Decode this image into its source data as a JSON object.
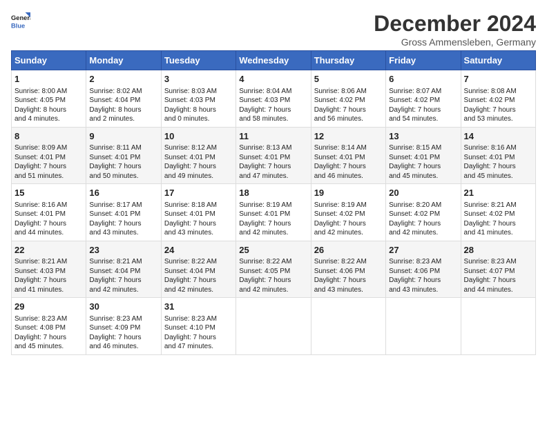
{
  "header": {
    "logo_line1": "General",
    "logo_line2": "Blue",
    "title": "December 2024",
    "subtitle": "Gross Ammensleben, Germany"
  },
  "columns": [
    "Sunday",
    "Monday",
    "Tuesday",
    "Wednesday",
    "Thursday",
    "Friday",
    "Saturday"
  ],
  "weeks": [
    [
      {
        "day": "1",
        "lines": [
          "Sunrise: 8:00 AM",
          "Sunset: 4:05 PM",
          "Daylight: 8 hours",
          "and 4 minutes."
        ]
      },
      {
        "day": "2",
        "lines": [
          "Sunrise: 8:02 AM",
          "Sunset: 4:04 PM",
          "Daylight: 8 hours",
          "and 2 minutes."
        ]
      },
      {
        "day": "3",
        "lines": [
          "Sunrise: 8:03 AM",
          "Sunset: 4:03 PM",
          "Daylight: 8 hours",
          "and 0 minutes."
        ]
      },
      {
        "day": "4",
        "lines": [
          "Sunrise: 8:04 AM",
          "Sunset: 4:03 PM",
          "Daylight: 7 hours",
          "and 58 minutes."
        ]
      },
      {
        "day": "5",
        "lines": [
          "Sunrise: 8:06 AM",
          "Sunset: 4:02 PM",
          "Daylight: 7 hours",
          "and 56 minutes."
        ]
      },
      {
        "day": "6",
        "lines": [
          "Sunrise: 8:07 AM",
          "Sunset: 4:02 PM",
          "Daylight: 7 hours",
          "and 54 minutes."
        ]
      },
      {
        "day": "7",
        "lines": [
          "Sunrise: 8:08 AM",
          "Sunset: 4:02 PM",
          "Daylight: 7 hours",
          "and 53 minutes."
        ]
      }
    ],
    [
      {
        "day": "8",
        "lines": [
          "Sunrise: 8:09 AM",
          "Sunset: 4:01 PM",
          "Daylight: 7 hours",
          "and 51 minutes."
        ]
      },
      {
        "day": "9",
        "lines": [
          "Sunrise: 8:11 AM",
          "Sunset: 4:01 PM",
          "Daylight: 7 hours",
          "and 50 minutes."
        ]
      },
      {
        "day": "10",
        "lines": [
          "Sunrise: 8:12 AM",
          "Sunset: 4:01 PM",
          "Daylight: 7 hours",
          "and 49 minutes."
        ]
      },
      {
        "day": "11",
        "lines": [
          "Sunrise: 8:13 AM",
          "Sunset: 4:01 PM",
          "Daylight: 7 hours",
          "and 47 minutes."
        ]
      },
      {
        "day": "12",
        "lines": [
          "Sunrise: 8:14 AM",
          "Sunset: 4:01 PM",
          "Daylight: 7 hours",
          "and 46 minutes."
        ]
      },
      {
        "day": "13",
        "lines": [
          "Sunrise: 8:15 AM",
          "Sunset: 4:01 PM",
          "Daylight: 7 hours",
          "and 45 minutes."
        ]
      },
      {
        "day": "14",
        "lines": [
          "Sunrise: 8:16 AM",
          "Sunset: 4:01 PM",
          "Daylight: 7 hours",
          "and 45 minutes."
        ]
      }
    ],
    [
      {
        "day": "15",
        "lines": [
          "Sunrise: 8:16 AM",
          "Sunset: 4:01 PM",
          "Daylight: 7 hours",
          "and 44 minutes."
        ]
      },
      {
        "day": "16",
        "lines": [
          "Sunrise: 8:17 AM",
          "Sunset: 4:01 PM",
          "Daylight: 7 hours",
          "and 43 minutes."
        ]
      },
      {
        "day": "17",
        "lines": [
          "Sunrise: 8:18 AM",
          "Sunset: 4:01 PM",
          "Daylight: 7 hours",
          "and 43 minutes."
        ]
      },
      {
        "day": "18",
        "lines": [
          "Sunrise: 8:19 AM",
          "Sunset: 4:01 PM",
          "Daylight: 7 hours",
          "and 42 minutes."
        ]
      },
      {
        "day": "19",
        "lines": [
          "Sunrise: 8:19 AM",
          "Sunset: 4:02 PM",
          "Daylight: 7 hours",
          "and 42 minutes."
        ]
      },
      {
        "day": "20",
        "lines": [
          "Sunrise: 8:20 AM",
          "Sunset: 4:02 PM",
          "Daylight: 7 hours",
          "and 42 minutes."
        ]
      },
      {
        "day": "21",
        "lines": [
          "Sunrise: 8:21 AM",
          "Sunset: 4:02 PM",
          "Daylight: 7 hours",
          "and 41 minutes."
        ]
      }
    ],
    [
      {
        "day": "22",
        "lines": [
          "Sunrise: 8:21 AM",
          "Sunset: 4:03 PM",
          "Daylight: 7 hours",
          "and 41 minutes."
        ]
      },
      {
        "day": "23",
        "lines": [
          "Sunrise: 8:21 AM",
          "Sunset: 4:04 PM",
          "Daylight: 7 hours",
          "and 42 minutes."
        ]
      },
      {
        "day": "24",
        "lines": [
          "Sunrise: 8:22 AM",
          "Sunset: 4:04 PM",
          "Daylight: 7 hours",
          "and 42 minutes."
        ]
      },
      {
        "day": "25",
        "lines": [
          "Sunrise: 8:22 AM",
          "Sunset: 4:05 PM",
          "Daylight: 7 hours",
          "and 42 minutes."
        ]
      },
      {
        "day": "26",
        "lines": [
          "Sunrise: 8:22 AM",
          "Sunset: 4:06 PM",
          "Daylight: 7 hours",
          "and 43 minutes."
        ]
      },
      {
        "day": "27",
        "lines": [
          "Sunrise: 8:23 AM",
          "Sunset: 4:06 PM",
          "Daylight: 7 hours",
          "and 43 minutes."
        ]
      },
      {
        "day": "28",
        "lines": [
          "Sunrise: 8:23 AM",
          "Sunset: 4:07 PM",
          "Daylight: 7 hours",
          "and 44 minutes."
        ]
      }
    ],
    [
      {
        "day": "29",
        "lines": [
          "Sunrise: 8:23 AM",
          "Sunset: 4:08 PM",
          "Daylight: 7 hours",
          "and 45 minutes."
        ]
      },
      {
        "day": "30",
        "lines": [
          "Sunrise: 8:23 AM",
          "Sunset: 4:09 PM",
          "Daylight: 7 hours",
          "and 46 minutes."
        ]
      },
      {
        "day": "31",
        "lines": [
          "Sunrise: 8:23 AM",
          "Sunset: 4:10 PM",
          "Daylight: 7 hours",
          "and 47 minutes."
        ]
      },
      null,
      null,
      null,
      null
    ]
  ]
}
